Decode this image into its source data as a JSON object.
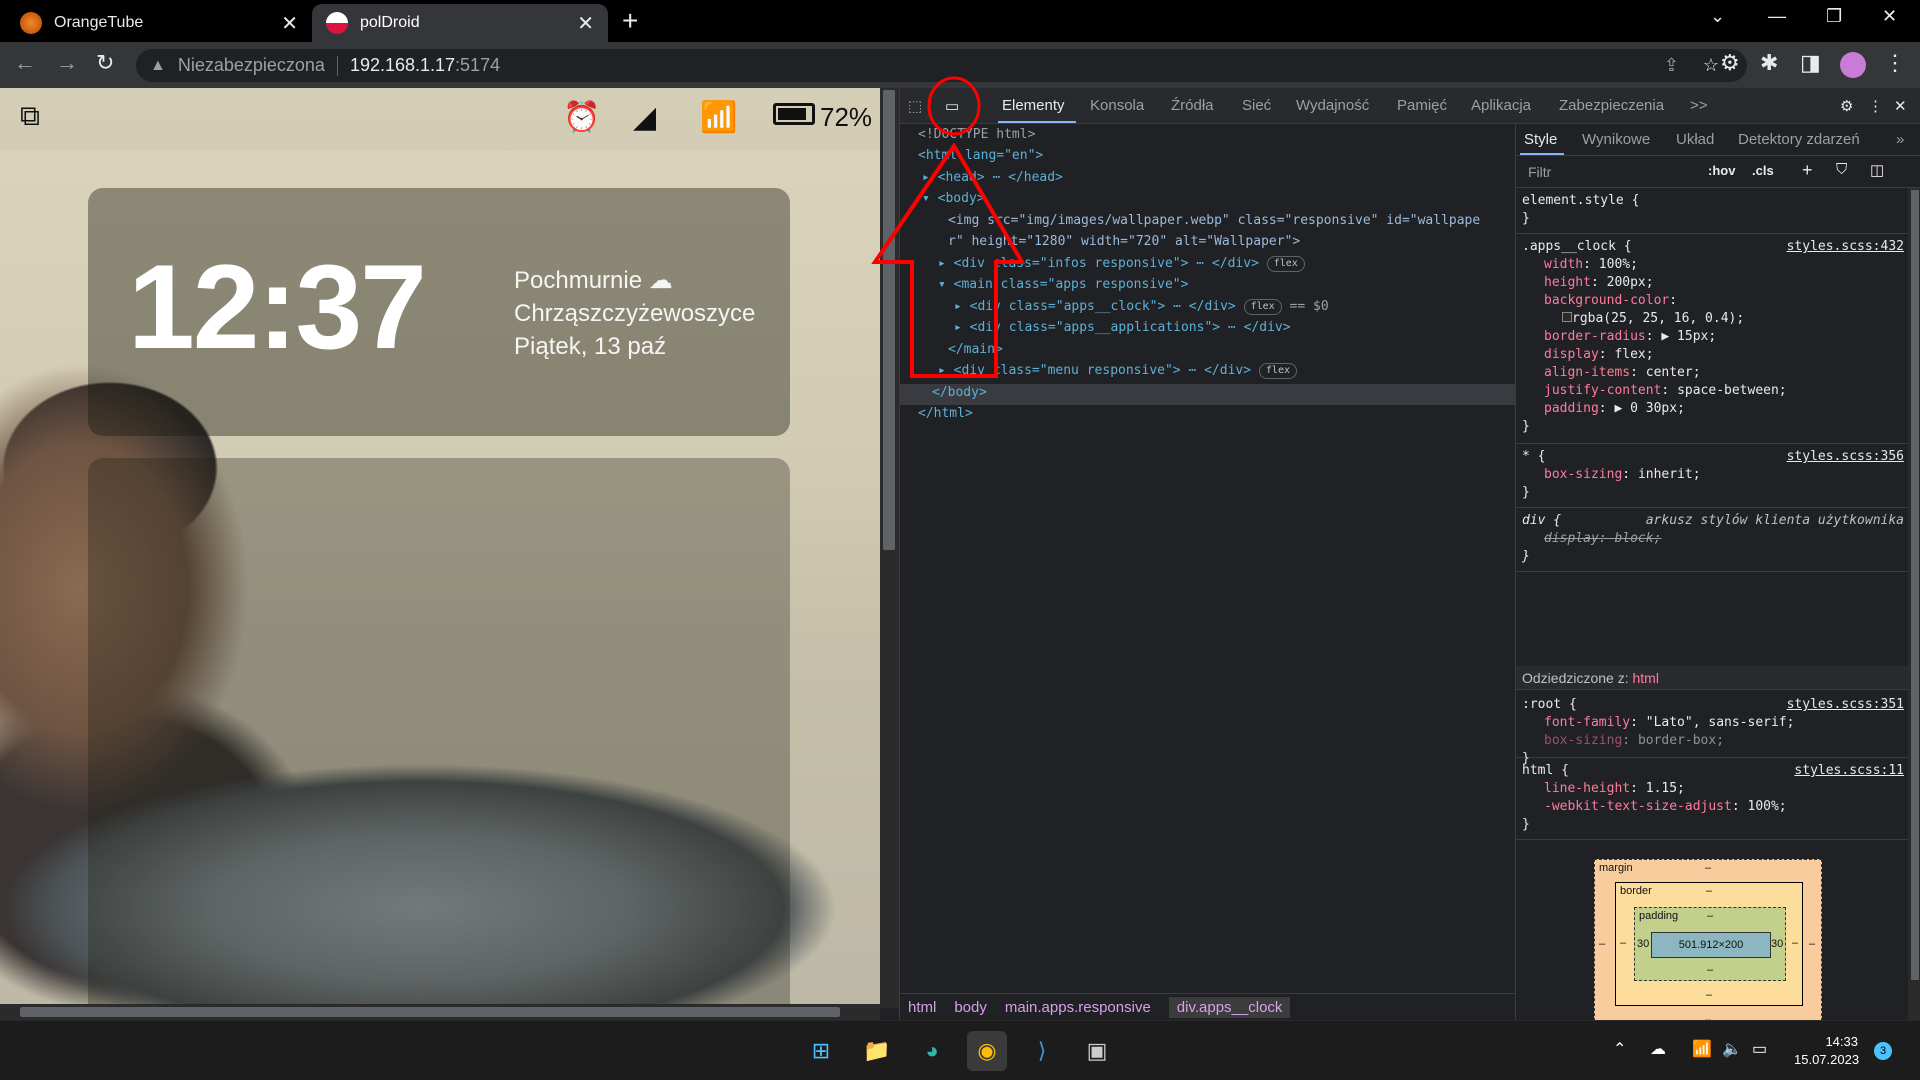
{
  "browser": {
    "tabs": [
      {
        "title": "OrangeTube",
        "active": false
      },
      {
        "title": "polDroid",
        "active": true
      }
    ],
    "new_tab_symbol": "+",
    "address": {
      "security": "Niezabezpieczona",
      "host": "192.168.1.17",
      "port": ":5174"
    }
  },
  "page": {
    "status": {
      "battery": "72%"
    },
    "clock": {
      "time": "12:37"
    },
    "weather": {
      "condition": "Pochmurnie",
      "city": "Chrząszczyżewoszyce",
      "date": "Piątek, 13 paź"
    }
  },
  "devtools": {
    "tabs": [
      "Elementy",
      "Konsola",
      "Źródła",
      "Sieć",
      "Wydajność",
      "Pamięć",
      "Aplikacja",
      "Zabezpieczenia"
    ],
    "more": ">>",
    "dom": [
      "<!DOCTYPE html>",
      "<html lang=\"en\">",
      "<head> ⋯ </head>",
      "<body>",
      "<img src=\"img/images/wallpaper.webp\" class=\"responsive\" id=\"wallpape",
      "r\" height=\"1280\" width=\"720\" alt=\"Wallpaper\">",
      "<div class=\"infos responsive\"> ⋯ </div>",
      "<main class=\"apps responsive\">",
      "<div class=\"apps__clock\"> ⋯ </div>",
      "<div class=\"apps__applications\"> ⋯ </div>",
      "</main>",
      "<div class=\"menu responsive\"> ⋯ </div>",
      "</body>",
      "</html>"
    ],
    "flex_badge": "flex",
    "selected_marker": "== $0",
    "breadcrumbs": [
      "html",
      "body",
      "main.apps.responsive",
      "div.apps__clock"
    ],
    "styles_tabs": [
      "Style",
      "Wynikowe",
      "Układ",
      "Detektory zdarzeń"
    ],
    "filter_placeholder": "Filtr",
    "filter_buttons": [
      ":hov",
      ".cls"
    ],
    "rules": [
      {
        "selector": "element.style {",
        "source": "",
        "props": [],
        "close": "}"
      },
      {
        "selector": ".apps__clock {",
        "source": "styles.scss:432",
        "props": [
          [
            "width",
            "100%;"
          ],
          [
            "height",
            "200px;"
          ],
          [
            "background-color",
            ""
          ],
          [
            "",
            "rgba(25, 25, 16, 0.4);"
          ],
          [
            "border-radius",
            "▶ 15px;"
          ],
          [
            "display",
            "flex;"
          ],
          [
            "align-items",
            "center;"
          ],
          [
            "justify-content",
            "space-between;"
          ],
          [
            "padding",
            "▶ 0 30px;"
          ]
        ],
        "close": "}"
      },
      {
        "selector": "* {",
        "source": "styles.scss:356",
        "props": [
          [
            "box-sizing",
            "inherit;"
          ]
        ],
        "close": "}"
      },
      {
        "selector": "div {",
        "source": "arkusz stylów klienta użytkownika",
        "props": [
          [
            "display",
            "block;"
          ]
        ],
        "close": "}"
      },
      {
        "selector": ":root {",
        "source": "styles.scss:351",
        "props": [
          [
            "font-family",
            "\"Lato\", sans-serif;"
          ],
          [
            "box-sizing",
            "border-box;"
          ]
        ],
        "close": "}"
      },
      {
        "selector": "html {",
        "source": "styles.scss:11",
        "props": [
          [
            "line-height",
            "1.15;"
          ],
          [
            "-webkit-text-size-adjust",
            "100%;"
          ]
        ],
        "close": "}"
      }
    ],
    "inherited_label": "Odziedziczone z:",
    "inherited_from": "html",
    "boxmodel": {
      "margin": "margin",
      "border": "border",
      "padding": "padding",
      "content": "501.912×200",
      "padding_lr": "30",
      "dash": "–"
    }
  },
  "taskbar": {
    "time": "14:33",
    "date": "15.07.2023",
    "badge": "3"
  },
  "colors": {
    "clock_card": "rgba(25,25,16,0.4)",
    "accent": "#8ab4f8",
    "annotation": "#ff0000"
  }
}
